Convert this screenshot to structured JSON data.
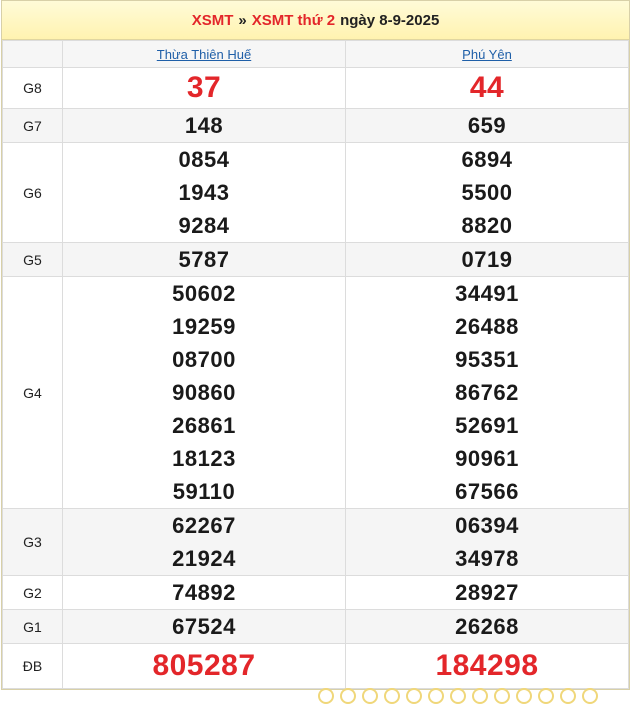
{
  "header": {
    "crumb1": "XSMT",
    "separator": "»",
    "crumb2": "XSMT thứ 2",
    "date_text": "ngày 8-9-2025"
  },
  "provinces": [
    "Thừa Thiên Huế",
    "Phú Yên"
  ],
  "prizes": [
    {
      "label": "G8",
      "col1": [
        "37"
      ],
      "col2": [
        "44"
      ]
    },
    {
      "label": "G7",
      "col1": [
        "148"
      ],
      "col2": [
        "659"
      ]
    },
    {
      "label": "G6",
      "col1": [
        "0854",
        "1943",
        "9284"
      ],
      "col2": [
        "6894",
        "5500",
        "8820"
      ]
    },
    {
      "label": "G5",
      "col1": [
        "5787"
      ],
      "col2": [
        "0719"
      ]
    },
    {
      "label": "G4",
      "col1": [
        "50602",
        "19259",
        "08700",
        "90860",
        "26861",
        "18123",
        "59110"
      ],
      "col2": [
        "34491",
        "26488",
        "95351",
        "86762",
        "52691",
        "90961",
        "67566"
      ]
    },
    {
      "label": "G3",
      "col1": [
        "62267",
        "21924"
      ],
      "col2": [
        "06394",
        "34978"
      ]
    },
    {
      "label": "G2",
      "col1": [
        "74892"
      ],
      "col2": [
        "28927"
      ]
    },
    {
      "label": "G1",
      "col1": [
        "67524"
      ],
      "col2": [
        "26268"
      ]
    },
    {
      "label": "ĐB",
      "col1": [
        "805287"
      ],
      "col2": [
        "184298"
      ]
    }
  ],
  "colors": {
    "accent_red": "#e3262a",
    "link_blue": "#1f5fa8",
    "header_bg": "#fff3b0"
  }
}
